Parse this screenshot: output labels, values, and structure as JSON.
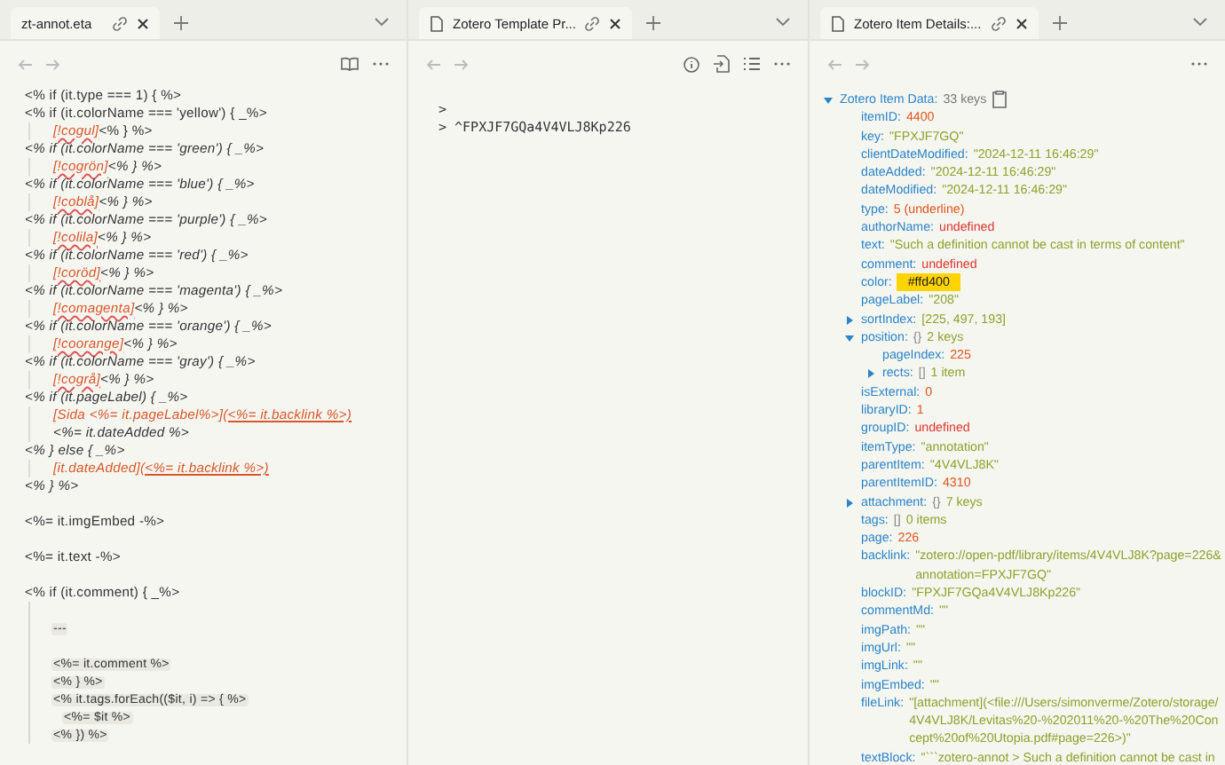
{
  "panes": [
    {
      "tab": {
        "title": "zt-annot.eta",
        "file_icon": false
      },
      "kind": "code"
    },
    {
      "tab": {
        "title": "Zotero Template Pr...",
        "file_icon": true
      },
      "kind": "quote"
    },
    {
      "tab": {
        "title": "Zotero Item Details:...",
        "file_icon": true
      },
      "kind": "tree"
    }
  ],
  "code": {
    "lines": [
      {
        "kind": "top",
        "segments": [
          {
            "kind": "code",
            "text": "<% if (it.type === 1) { %>"
          }
        ]
      },
      {
        "kind": "top",
        "segments": [
          {
            "kind": "code",
            "text": "<% if (it.colorName === 'yellow') { _%>"
          }
        ]
      },
      {
        "kind": "nested",
        "segments": [
          {
            "kind": "tag",
            "text": "[!cogul]"
          },
          {
            "kind": "code",
            "text": "<% } %>"
          }
        ]
      },
      {
        "kind": "top",
        "segments": [
          {
            "kind": "em",
            "text": "<% if (it.colorName === 'green') { _%>"
          }
        ]
      },
      {
        "kind": "nested",
        "segments": [
          {
            "kind": "tag",
            "text": "[!cogrön]"
          },
          {
            "kind": "em",
            "text": "<% } %>"
          }
        ]
      },
      {
        "kind": "top",
        "segments": [
          {
            "kind": "em",
            "text": "<% if (it.colorName === 'blue') { _%>"
          }
        ]
      },
      {
        "kind": "nested",
        "segments": [
          {
            "kind": "tag",
            "text": "[!coblå]"
          },
          {
            "kind": "em",
            "text": "<% } %>"
          }
        ]
      },
      {
        "kind": "top",
        "segments": [
          {
            "kind": "em",
            "text": "<% if (it.colorName === 'purple') { _%>"
          }
        ]
      },
      {
        "kind": "nested",
        "segments": [
          {
            "kind": "tag",
            "text": "[!colila]"
          },
          {
            "kind": "em",
            "text": "<% } %>"
          }
        ]
      },
      {
        "kind": "top",
        "segments": [
          {
            "kind": "em",
            "text": "<% if (it.colorName === 'red') { _%>"
          }
        ]
      },
      {
        "kind": "nested",
        "segments": [
          {
            "kind": "tag",
            "text": "[!coröd]"
          },
          {
            "kind": "em",
            "text": "<% } %>"
          }
        ]
      },
      {
        "kind": "top",
        "segments": [
          {
            "kind": "em",
            "text": "<% if (it.colorName === 'magenta') { _%>"
          }
        ]
      },
      {
        "kind": "nested",
        "segments": [
          {
            "kind": "tag",
            "text": "[!comagenta]"
          },
          {
            "kind": "em",
            "text": "<% } %>"
          }
        ]
      },
      {
        "kind": "top",
        "segments": [
          {
            "kind": "em",
            "text": "<% if (it.colorName === 'orange') { _%>"
          }
        ]
      },
      {
        "kind": "nested",
        "segments": [
          {
            "kind": "tag",
            "text": "[!coorange]"
          },
          {
            "kind": "em",
            "text": "<% } %>"
          }
        ]
      },
      {
        "kind": "top",
        "segments": [
          {
            "kind": "em",
            "text": "<% if (it.colorName === 'gray') { _%>"
          }
        ]
      },
      {
        "kind": "nested",
        "segments": [
          {
            "kind": "tag",
            "text": "[!cogrå]"
          },
          {
            "kind": "em",
            "text": "<% } %>"
          }
        ]
      },
      {
        "kind": "top",
        "segments": [
          {
            "kind": "em",
            "text": "<% if (it.pageLabel) { _%>"
          }
        ]
      },
      {
        "kind": "nested",
        "segments": [
          {
            "kind": "bracket",
            "text": "[Sida <%= it.pageLabel%>]"
          },
          {
            "kind": "link",
            "text": "(<%= it.backlink %>)"
          }
        ]
      },
      {
        "kind": "nested",
        "segments": [
          {
            "kind": "em",
            "text": "<%= it.dateAdded %>"
          }
        ]
      },
      {
        "kind": "top",
        "segments": [
          {
            "kind": "em",
            "text": "<% } else { _%>"
          }
        ]
      },
      {
        "kind": "nested",
        "segments": [
          {
            "kind": "bracket",
            "text": "[it.dateAdded]"
          },
          {
            "kind": "link",
            "text": "(<%= it.backlink %>)"
          }
        ]
      },
      {
        "kind": "top",
        "segments": [
          {
            "kind": "em",
            "text": "<% } %>"
          }
        ]
      },
      {
        "kind": "blank"
      },
      {
        "kind": "top",
        "segments": [
          {
            "kind": "code",
            "text": "<%= it.imgEmbed -%>"
          }
        ]
      },
      {
        "kind": "blank"
      },
      {
        "kind": "top",
        "segments": [
          {
            "kind": "code",
            "text": "<%= it.text -%>"
          }
        ]
      },
      {
        "kind": "blank"
      },
      {
        "kind": "top",
        "segments": [
          {
            "kind": "code",
            "text": "<% if (it.comment) { _%>"
          }
        ]
      },
      {
        "kind": "callout-blank"
      },
      {
        "kind": "callout",
        "segments": [
          {
            "kind": "inline",
            "text": "---"
          }
        ]
      },
      {
        "kind": "callout-blank"
      },
      {
        "kind": "callout",
        "segments": [
          {
            "kind": "inline",
            "text": "<%= it.comment %>"
          }
        ]
      },
      {
        "kind": "callout",
        "segments": [
          {
            "kind": "inline",
            "text": "<% } %>"
          }
        ]
      },
      {
        "kind": "callout",
        "segments": [
          {
            "kind": "inline",
            "text": "<% it.tags.forEach(($it, i) => { %>"
          }
        ]
      },
      {
        "kind": "callout-nested",
        "segments": [
          {
            "kind": "inline",
            "text": "<%= $it %>"
          }
        ]
      },
      {
        "kind": "callout",
        "segments": [
          {
            "kind": "inline",
            "text": "<% }) %>"
          }
        ]
      }
    ]
  },
  "quote": {
    "lines": [
      ">",
      "> ^FPXJF7GQa4V4VLJ8Kp226"
    ]
  },
  "tree": {
    "key": "Zotero Item Data:",
    "count": "33 keys",
    "expanded": true,
    "children": [
      {
        "key": "itemID:",
        "value": "4400",
        "kind": "number"
      },
      {
        "key": "key:",
        "value": "\"FPXJF7GQ\"",
        "kind": "string"
      },
      {
        "key": "clientDateModified:",
        "value": "\"2024-12-11 16:46:29\"",
        "kind": "string"
      },
      {
        "key": "dateAdded:",
        "value": "\"2024-12-11 16:46:29\"",
        "kind": "string"
      },
      {
        "key": "dateModified:",
        "value": "\"2024-12-11 16:46:29\"",
        "kind": "string"
      },
      {
        "key": "type:",
        "value": "5 (underline)",
        "kind": "number"
      },
      {
        "key": "authorName:",
        "value": "undefined",
        "kind": "undefined"
      },
      {
        "key": "text:",
        "value": "\"Such a definition cannot be cast in terms of content\"",
        "kind": "string"
      },
      {
        "key": "comment:",
        "value": "undefined",
        "kind": "undefined"
      },
      {
        "key": "color:",
        "value": "#ffd400",
        "kind": "color"
      },
      {
        "key": "pageLabel:",
        "value": "\"208\"",
        "kind": "string"
      },
      {
        "key": "sortIndex:",
        "value": "[225, 497, 193]",
        "kind": "string",
        "expanded": false
      },
      {
        "key": "position:",
        "brace": "{}",
        "count": "2 keys",
        "expanded": true,
        "children": [
          {
            "key": "pageIndex:",
            "value": "225",
            "kind": "number"
          },
          {
            "key": "rects:",
            "brace": "[]",
            "count": "1 item",
            "expanded": false
          }
        ]
      },
      {
        "key": "isExternal:",
        "value": "0",
        "kind": "number"
      },
      {
        "key": "libraryID:",
        "value": "1",
        "kind": "number"
      },
      {
        "key": "groupID:",
        "value": "undefined",
        "kind": "undefined"
      },
      {
        "key": "itemType:",
        "value": "\"annotation\"",
        "kind": "string"
      },
      {
        "key": "parentItem:",
        "value": "\"4V4VLJ8K\"",
        "kind": "string"
      },
      {
        "key": "parentItemID:",
        "value": "4310",
        "kind": "number"
      },
      {
        "key": "attachment:",
        "brace": "{}",
        "count": "7 keys",
        "expanded": false
      },
      {
        "key": "tags:",
        "brace": "[]",
        "count": "0 items"
      },
      {
        "key": "page:",
        "value": "226",
        "kind": "number"
      },
      {
        "key": "backlink:",
        "value": "\"zotero://open-pdf/library/items/4V4VLJ8K?page=226&annotation=FPXJF7GQ\"",
        "kind": "string"
      },
      {
        "key": "blockID:",
        "value": "\"FPXJF7GQa4V4VLJ8Kp226\"",
        "kind": "string"
      },
      {
        "key": "commentMd:",
        "value": "\"\"",
        "kind": "string"
      },
      {
        "key": "imgPath:",
        "value": "\"\"",
        "kind": "string"
      },
      {
        "key": "imgUrl:",
        "value": "\"\"",
        "kind": "string"
      },
      {
        "key": "imgLink:",
        "value": "\"\"",
        "kind": "string"
      },
      {
        "key": "imgEmbed:",
        "value": "\"\"",
        "kind": "string"
      },
      {
        "key": "fileLink:",
        "value": "\"[attachment](<file:///Users/simonverme/Zotero/storage/4V4VLJ8K/Levitas%20-%202011%20-%20The%20Concept%20of%20Utopia.pdf#page=226>)\"",
        "kind": "string"
      },
      {
        "key": "textBlock:",
        "value": "\"```zotero-annot > Such a definition cannot be cast in",
        "kind": "string"
      }
    ]
  }
}
